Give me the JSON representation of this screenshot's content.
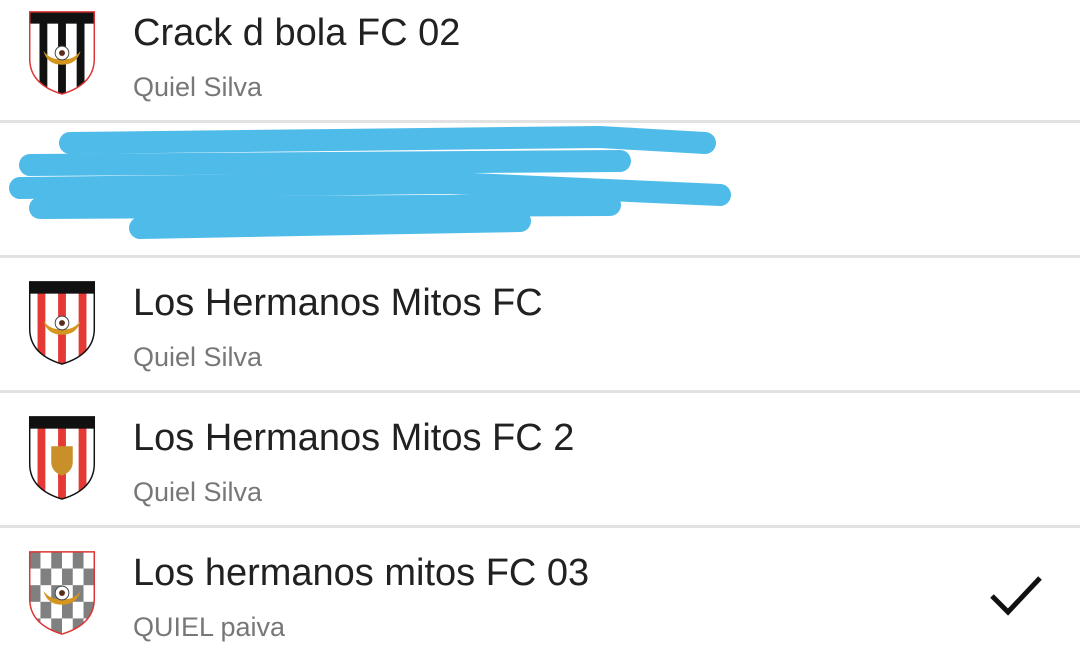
{
  "teams": [
    {
      "name": "Crack d bola FC 02",
      "owner": "Quiel Silva",
      "crest": "black-white-stripes-crest-icon"
    },
    {
      "redacted": true,
      "crest": "redacted-crest-icon"
    },
    {
      "name": "Los Hermanos Mitos FC",
      "owner": "Quiel Silva",
      "crest": "red-white-stripes-crest-icon"
    },
    {
      "name": "Los Hermanos Mitos FC 2",
      "owner": "Quiel Silva",
      "crest": "red-white-stripes-shield-crest-icon"
    },
    {
      "name": "Los hermanos mitos FC 03",
      "owner": "QUIEL paiva",
      "crest": "gray-checkered-crest-icon",
      "selected": true
    }
  ],
  "colors": {
    "redaction": "#4fbbe9",
    "divider": "#e2e2e2",
    "title": "#212121",
    "subtitle": "#777777"
  }
}
